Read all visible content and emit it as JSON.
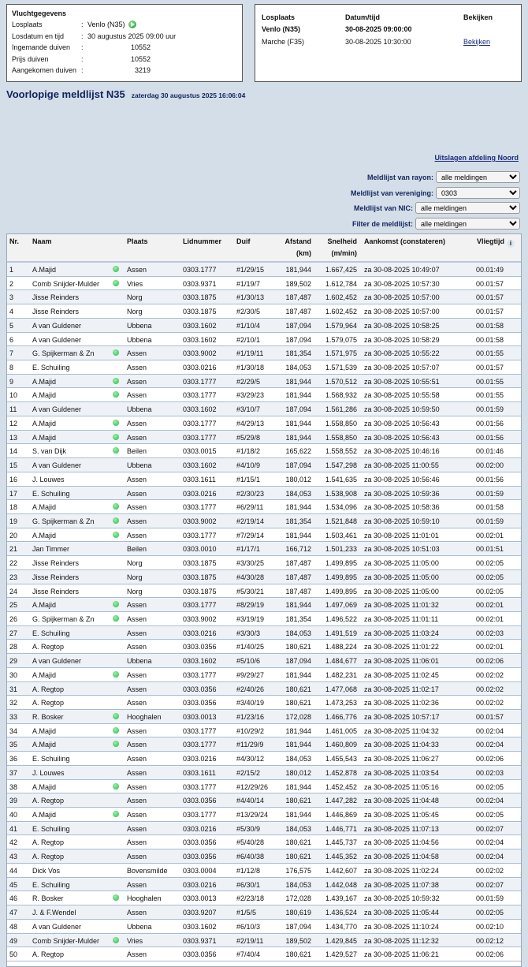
{
  "flight": {
    "heading": "Vluchtgegevens",
    "rows": [
      {
        "label": "Losplaats",
        "value": "Venlo (N35)"
      },
      {
        "label": "Losdatum en tijd",
        "value": "30 augustus 2025 09:00 uur"
      },
      {
        "label": "Ingemande duiven",
        "value": "10552"
      },
      {
        "label": "Prijs duiven",
        "value": "10552"
      },
      {
        "label": "Aangekomen duiven",
        "value": "3219"
      }
    ],
    "colon": ":"
  },
  "releases": {
    "headers": [
      "Losplaats",
      "Datum/tijd",
      "Bekijken"
    ],
    "rows": [
      {
        "place": "Venlo (N35)",
        "datetime": "30-08-2025 09:00:00",
        "link": ""
      },
      {
        "place": "Marche (F35)",
        "datetime": "30-08-2025 10:30:00",
        "link": "Bekijken"
      }
    ]
  },
  "title": "Voorlopige meldlijst N35",
  "subtitle": "zaterdag 30 augustus 2025 16:06:04",
  "dept_link": "Uitslagen afdeling Noord",
  "filters": [
    {
      "label": "Meldlijst van rayon:",
      "value": "alle meldingen"
    },
    {
      "label": "Meldlijst van vereniging:",
      "value": "0303"
    },
    {
      "label": "Meldlijst van NIC:",
      "value": "alle meldingen"
    },
    {
      "label": "Filter de meldlijst:",
      "value": "alle meldingen"
    }
  ],
  "table": {
    "headers": {
      "nr": "Nr.",
      "naam": "Naam",
      "plaats": "Plaats",
      "lid": "Lidnummer",
      "duif": "Duif",
      "afstand": "Afstand",
      "afstand_unit": "(km)",
      "snelheid": "Snelheid",
      "snelheid_unit": "(m/min)",
      "aankomst": "Aankomst (constateren)",
      "vliegtijd": "Vliegtijd",
      "info": "i"
    },
    "rows": [
      [
        "1",
        "A.Majid",
        true,
        "Assen",
        "0303.1777",
        "#1/29/15",
        "181,944",
        "1.667,425",
        "za 30-08-2025 10:49:07",
        "00.01:49"
      ],
      [
        "2",
        "Comb Snijder-Mulder",
        true,
        "Vries",
        "0303.9371",
        "#1/19/7",
        "189,502",
        "1.612,784",
        "za 30-08-2025 10:57:30",
        "00.01:57"
      ],
      [
        "3",
        "Jisse Reinders",
        false,
        "Norg",
        "0303.1875",
        "#1/30/13",
        "187,487",
        "1.602,452",
        "za 30-08-2025 10:57:00",
        "00.01:57"
      ],
      [
        "4",
        "Jisse Reinders",
        false,
        "Norg",
        "0303.1875",
        "#2/30/5",
        "187,487",
        "1.602,452",
        "za 30-08-2025 10:57:00",
        "00.01:57"
      ],
      [
        "5",
        "A van Guldener",
        false,
        "Ubbena",
        "0303.1602",
        "#1/10/4",
        "187,094",
        "1.579,964",
        "za 30-08-2025 10:58:25",
        "00.01:58"
      ],
      [
        "6",
        "A van Guldener",
        false,
        "Ubbena",
        "0303.1602",
        "#2/10/1",
        "187,094",
        "1.579,075",
        "za 30-08-2025 10:58:29",
        "00.01:58"
      ],
      [
        "7",
        "G. Spijkerman & Zn",
        true,
        "Assen",
        "0303.9002",
        "#1/19/11",
        "181,354",
        "1.571,975",
        "za 30-08-2025 10:55:22",
        "00.01:55"
      ],
      [
        "8",
        "E. Schuiling",
        false,
        "Assen",
        "0303.0216",
        "#1/30/18",
        "184,053",
        "1.571,539",
        "za 30-08-2025 10:57:07",
        "00.01:57"
      ],
      [
        "9",
        "A.Majid",
        true,
        "Assen",
        "0303.1777",
        "#2/29/5",
        "181,944",
        "1.570,512",
        "za 30-08-2025 10:55:51",
        "00.01:55"
      ],
      [
        "10",
        "A.Majid",
        true,
        "Assen",
        "0303.1777",
        "#3/29/23",
        "181,944",
        "1.568,932",
        "za 30-08-2025 10:55:58",
        "00.01:55"
      ],
      [
        "11",
        "A van Guldener",
        false,
        "Ubbena",
        "0303.1602",
        "#3/10/7",
        "187,094",
        "1.561,286",
        "za 30-08-2025 10:59:50",
        "00.01:59"
      ],
      [
        "12",
        "A.Majid",
        true,
        "Assen",
        "0303.1777",
        "#4/29/13",
        "181,944",
        "1.558,850",
        "za 30-08-2025 10:56:43",
        "00.01:56"
      ],
      [
        "13",
        "A.Majid",
        true,
        "Assen",
        "0303.1777",
        "#5/29/8",
        "181,944",
        "1.558,850",
        "za 30-08-2025 10:56:43",
        "00.01:56"
      ],
      [
        "14",
        "S. van Dijk",
        true,
        "Beilen",
        "0303.0015",
        "#1/18/2",
        "165,622",
        "1.558,552",
        "za 30-08-2025 10:46:16",
        "00.01:46"
      ],
      [
        "15",
        "A van Guldener",
        false,
        "Ubbena",
        "0303.1602",
        "#4/10/9",
        "187,094",
        "1.547,298",
        "za 30-08-2025 11:00:55",
        "00.02:00"
      ],
      [
        "16",
        "J. Louwes",
        false,
        "Assen",
        "0303.1611",
        "#1/15/1",
        "180,012",
        "1.541,635",
        "za 30-08-2025 10:56:46",
        "00.01:56"
      ],
      [
        "17",
        "E. Schuiling",
        false,
        "Assen",
        "0303.0216",
        "#2/30/23",
        "184,053",
        "1.538,908",
        "za 30-08-2025 10:59:36",
        "00.01:59"
      ],
      [
        "18",
        "A.Majid",
        true,
        "Assen",
        "0303.1777",
        "#6/29/11",
        "181,944",
        "1.534,096",
        "za 30-08-2025 10:58:36",
        "00.01:58"
      ],
      [
        "19",
        "G. Spijkerman & Zn",
        true,
        "Assen",
        "0303.9002",
        "#2/19/14",
        "181,354",
        "1.521,848",
        "za 30-08-2025 10:59:10",
        "00.01:59"
      ],
      [
        "20",
        "A.Majid",
        true,
        "Assen",
        "0303.1777",
        "#7/29/14",
        "181,944",
        "1.503,461",
        "za 30-08-2025 11:01:01",
        "00.02:01"
      ],
      [
        "21",
        "Jan Timmer",
        false,
        "Beilen",
        "0303.0010",
        "#1/17/1",
        "166,712",
        "1.501,233",
        "za 30-08-2025 10:51:03",
        "00.01:51"
      ],
      [
        "22",
        "Jisse Reinders",
        false,
        "Norg",
        "0303.1875",
        "#3/30/25",
        "187,487",
        "1.499,895",
        "za 30-08-2025 11:05:00",
        "00.02:05"
      ],
      [
        "23",
        "Jisse Reinders",
        false,
        "Norg",
        "0303.1875",
        "#4/30/28",
        "187,487",
        "1.499,895",
        "za 30-08-2025 11:05:00",
        "00.02:05"
      ],
      [
        "24",
        "Jisse Reinders",
        false,
        "Norg",
        "0303.1875",
        "#5/30/21",
        "187,487",
        "1.499,895",
        "za 30-08-2025 11:05:00",
        "00.02:05"
      ],
      [
        "25",
        "A.Majid",
        true,
        "Assen",
        "0303.1777",
        "#8/29/19",
        "181,944",
        "1.497,069",
        "za 30-08-2025 11:01:32",
        "00.02:01"
      ],
      [
        "26",
        "G. Spijkerman & Zn",
        true,
        "Assen",
        "0303.9002",
        "#3/19/19",
        "181,354",
        "1.496,522",
        "za 30-08-2025 11:01:11",
        "00.02:01"
      ],
      [
        "27",
        "E. Schuiling",
        false,
        "Assen",
        "0303.0216",
        "#3/30/3",
        "184,053",
        "1.491,519",
        "za 30-08-2025 11:03:24",
        "00.02:03"
      ],
      [
        "28",
        "A. Regtop",
        false,
        "Assen",
        "0303.0356",
        "#1/40/25",
        "180,621",
        "1.488,224",
        "za 30-08-2025 11:01:22",
        "00.02:01"
      ],
      [
        "29",
        "A van Guldener",
        false,
        "Ubbena",
        "0303.1602",
        "#5/10/6",
        "187,094",
        "1.484,677",
        "za 30-08-2025 11:06:01",
        "00.02:06"
      ],
      [
        "30",
        "A.Majid",
        true,
        "Assen",
        "0303.1777",
        "#9/29/27",
        "181,944",
        "1.482,231",
        "za 30-08-2025 11:02:45",
        "00.02:02"
      ],
      [
        "31",
        "A. Regtop",
        false,
        "Assen",
        "0303.0356",
        "#2/40/26",
        "180,621",
        "1.477,068",
        "za 30-08-2025 11:02:17",
        "00.02:02"
      ],
      [
        "32",
        "A. Regtop",
        false,
        "Assen",
        "0303.0356",
        "#3/40/19",
        "180,621",
        "1.473,253",
        "za 30-08-2025 11:02:36",
        "00.02:02"
      ],
      [
        "33",
        "R. Bosker",
        true,
        "Hooghalen",
        "0303.0013",
        "#1/23/16",
        "172,028",
        "1.466,776",
        "za 30-08-2025 10:57:17",
        "00.01:57"
      ],
      [
        "34",
        "A.Majid",
        true,
        "Assen",
        "0303.1777",
        "#10/29/2",
        "181,944",
        "1.461,005",
        "za 30-08-2025 11:04:32",
        "00.02:04"
      ],
      [
        "35",
        "A.Majid",
        true,
        "Assen",
        "0303.1777",
        "#11/29/9",
        "181,944",
        "1.460,809",
        "za 30-08-2025 11:04:33",
        "00.02:04"
      ],
      [
        "36",
        "E. Schuiling",
        false,
        "Assen",
        "0303.0216",
        "#4/30/12",
        "184,053",
        "1.455,543",
        "za 30-08-2025 11:06:27",
        "00.02:06"
      ],
      [
        "37",
        "J. Louwes",
        false,
        "Assen",
        "0303.1611",
        "#2/15/2",
        "180,012",
        "1.452,878",
        "za 30-08-2025 11:03:54",
        "00.02:03"
      ],
      [
        "38",
        "A.Majid",
        true,
        "Assen",
        "0303.1777",
        "#12/29/26",
        "181,944",
        "1.452,452",
        "za 30-08-2025 11:05:16",
        "00.02:05"
      ],
      [
        "39",
        "A. Regtop",
        false,
        "Assen",
        "0303.0356",
        "#4/40/14",
        "180,621",
        "1.447,282",
        "za 30-08-2025 11:04:48",
        "00.02:04"
      ],
      [
        "40",
        "A.Majid",
        true,
        "Assen",
        "0303.1777",
        "#13/29/24",
        "181,944",
        "1.446,869",
        "za 30-08-2025 11:05:45",
        "00.02:05"
      ],
      [
        "41",
        "E. Schuiling",
        false,
        "Assen",
        "0303.0216",
        "#5/30/9",
        "184,053",
        "1.446,771",
        "za 30-08-2025 11:07:13",
        "00.02:07"
      ],
      [
        "42",
        "A. Regtop",
        false,
        "Assen",
        "0303.0356",
        "#5/40/28",
        "180,621",
        "1.445,737",
        "za 30-08-2025 11:04:56",
        "00.02:04"
      ],
      [
        "43",
        "A. Regtop",
        false,
        "Assen",
        "0303.0356",
        "#6/40/38",
        "180,621",
        "1.445,352",
        "za 30-08-2025 11:04:58",
        "00.02:04"
      ],
      [
        "44",
        "Dick Vos",
        false,
        "Bovensmilde",
        "0303.0004",
        "#1/12/8",
        "176,575",
        "1.442,607",
        "za 30-08-2025 11:02:24",
        "00.02:02"
      ],
      [
        "45",
        "E. Schuiling",
        false,
        "Assen",
        "0303.0216",
        "#6/30/1",
        "184,053",
        "1.442,048",
        "za 30-08-2025 11:07:38",
        "00.02:07"
      ],
      [
        "46",
        "R. Bosker",
        true,
        "Hooghalen",
        "0303.0013",
        "#2/23/18",
        "172,028",
        "1.439,167",
        "za 30-08-2025 10:59:32",
        "00.01:59"
      ],
      [
        "47",
        "J. & F.Wendel",
        false,
        "Assen",
        "0303.9207",
        "#1/5/5",
        "180,619",
        "1.436,524",
        "za 30-08-2025 11:05:44",
        "00.02:05"
      ],
      [
        "48",
        "A van Guldener",
        false,
        "Ubbena",
        "0303.1602",
        "#6/10/3",
        "187,094",
        "1.434,770",
        "za 30-08-2025 11:10:24",
        "00.02:10"
      ],
      [
        "49",
        "Comb Snijder-Mulder",
        true,
        "Vries",
        "0303.9371",
        "#2/19/11",
        "189,502",
        "1.429,845",
        "za 30-08-2025 11:12:32",
        "00.02:12"
      ],
      [
        "50",
        "A. Regtop",
        false,
        "Assen",
        "0303.0356",
        "#7/40/4",
        "180,621",
        "1.429,527",
        "za 30-08-2025 11:06:21",
        "00.02:06"
      ]
    ]
  }
}
